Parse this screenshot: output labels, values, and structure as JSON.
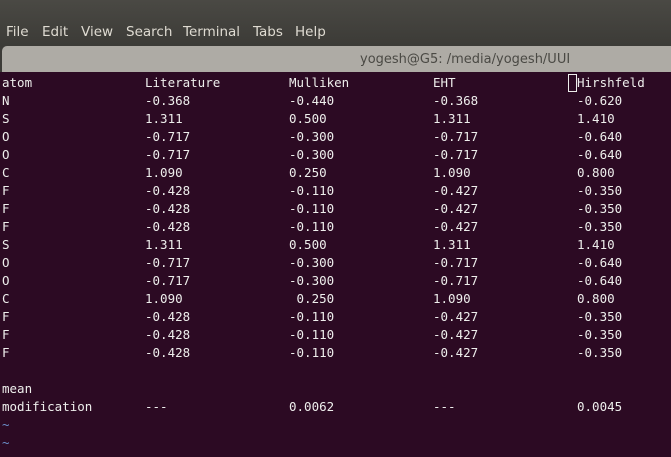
{
  "menu": [
    "File",
    "Edit",
    "View",
    "Search",
    "Terminal",
    "Tabs",
    "Help"
  ],
  "window_title": "yogesh@G5: /media/yogesh/UUI",
  "table": {
    "headers": [
      "atom",
      "Literature",
      "Mulliken",
      "EHT",
      "Hirshfeld"
    ],
    "rows": [
      [
        "N",
        "-0.368",
        "-0.440",
        "-0.368",
        "-0.620"
      ],
      [
        "S",
        "1.311",
        "0.500",
        "1.311",
        "1.410"
      ],
      [
        "O",
        "-0.717",
        "-0.300",
        "-0.717",
        "-0.640"
      ],
      [
        "O",
        "-0.717",
        "-0.300",
        "-0.717",
        "-0.640"
      ],
      [
        "C",
        "1.090",
        "0.250",
        "1.090",
        "0.800"
      ],
      [
        "F",
        "-0.428",
        "-0.110",
        "-0.427",
        "-0.350"
      ],
      [
        "F",
        "-0.428",
        "-0.110",
        "-0.427",
        "-0.350"
      ],
      [
        "F",
        "-0.428",
        "-0.110",
        "-0.427",
        "-0.350"
      ],
      [
        "S",
        "1.311",
        "0.500",
        "1.311",
        "1.410"
      ],
      [
        "O",
        "-0.717",
        "-0.300",
        "-0.717",
        "-0.640"
      ],
      [
        "O",
        "-0.717",
        "-0.300",
        "-0.717",
        "-0.640"
      ],
      [
        "C",
        "1.090",
        " 0.250",
        "1.090",
        "0.800"
      ],
      [
        "F",
        "-0.428",
        "-0.110",
        "-0.427",
        "-0.350"
      ],
      [
        "F",
        "-0.428",
        "-0.110",
        "-0.427",
        "-0.350"
      ],
      [
        "F",
        "-0.428",
        "-0.110",
        "-0.427",
        "-0.350"
      ]
    ],
    "summary_label_1": "mean",
    "summary": [
      "modification",
      "---",
      "0.0062",
      "---",
      "0.0045"
    ]
  },
  "tildes": [
    "~",
    "~"
  ]
}
